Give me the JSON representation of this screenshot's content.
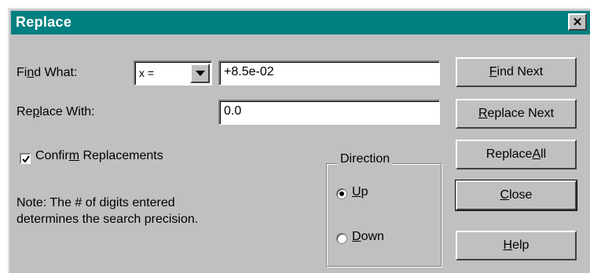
{
  "window": {
    "title": "Replace",
    "close_symbol": "✕"
  },
  "find": {
    "label_pre": "Fi",
    "label_key": "n",
    "label_post": "d What:",
    "operator_value": "x =",
    "value": "+8.5e-02"
  },
  "replace": {
    "label_pre": "Re",
    "label_key": "p",
    "label_post": "lace With:",
    "value": "0.0"
  },
  "confirm": {
    "checked": true,
    "label_pre": "Confir",
    "label_key": "m",
    "label_post": " Replacements"
  },
  "note": {
    "line1": "Note: The # of digits entered",
    "line2": "determines the search precision."
  },
  "direction": {
    "legend": "Direction",
    "up": {
      "selected": true,
      "label_key": "U",
      "label_post": "p"
    },
    "down": {
      "selected": false,
      "label_key": "D",
      "label_post": "own"
    }
  },
  "buttons": {
    "find_next": {
      "key": "F",
      "rest": "ind Next"
    },
    "replace_next": {
      "key": "R",
      "rest": "eplace Next"
    },
    "replace_all": {
      "pre": "Replace ",
      "key": "A",
      "rest": "ll"
    },
    "close": {
      "key": "C",
      "rest": "lose"
    },
    "help": {
      "key": "H",
      "rest": "elp"
    }
  }
}
